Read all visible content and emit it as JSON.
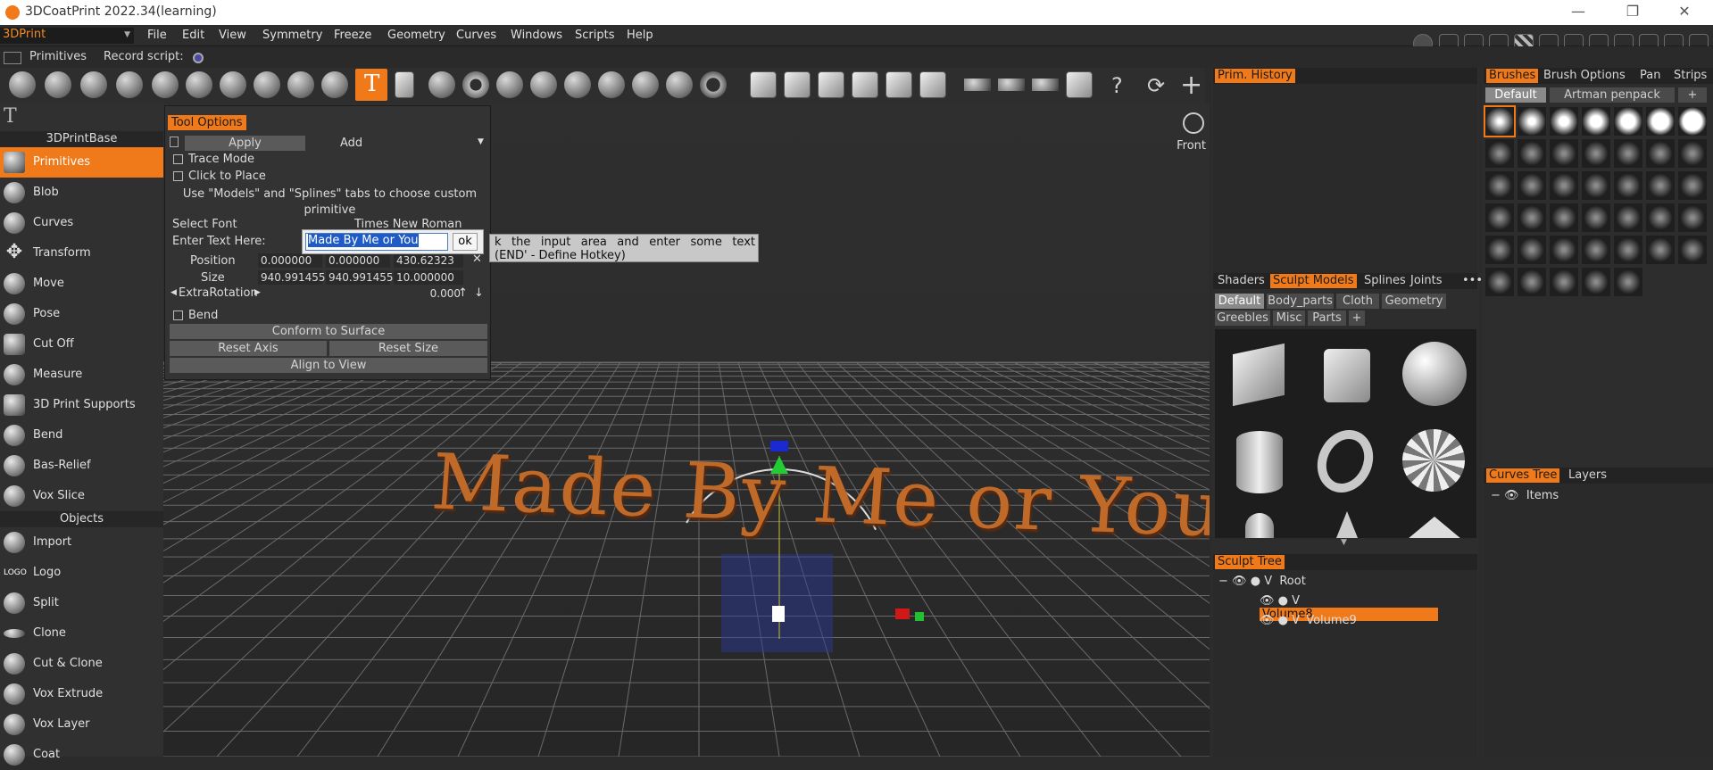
{
  "window": {
    "title": "3DCoatPrint 2022.34(learning)",
    "minimize": "—",
    "restore": "❐",
    "close": "✕"
  },
  "menubar": {
    "room_selector": "3DPrint",
    "items": [
      "File",
      "Edit",
      "View",
      "Symmetry",
      "Freeze",
      "Geometry",
      "Curves",
      "Windows",
      "Scripts",
      "Help"
    ]
  },
  "subbar": {
    "mode": "Primitives",
    "record_label": "Record script:"
  },
  "left_panel": {
    "section1": "3DPrintBase",
    "tools": [
      "Primitives",
      "Blob",
      "Curves",
      "Transform",
      "Move",
      "Pose",
      "Cut Off",
      "Measure",
      "3D Print Supports",
      "Bend",
      "Bas-Relief",
      "Vox Slice"
    ],
    "section2": "Objects",
    "objects": [
      "Import",
      "Logo",
      "Split",
      "Clone",
      "Cut & Clone",
      "Vox Extrude",
      "Vox Layer",
      "Coat"
    ],
    "logo_icon_text": "LOGO",
    "selected": "Primitives"
  },
  "tool_options": {
    "tab": "Tool Options",
    "apply": "Apply",
    "add": "Add",
    "trace_mode": "Trace Mode",
    "click_to_place": "Click to Place",
    "hint": "Use \"Models\" and \"Splines\" tabs to choose custom primitive",
    "select_font": "Select Font",
    "font_value": "Times New Roman",
    "enter_text": "Enter Text Here:",
    "text_value": "Made By Me or You",
    "ok": "ok",
    "position_label": "Position",
    "position": [
      "0.000000",
      "0.000000",
      "430.62323"
    ],
    "size_label": "Size",
    "size": [
      "940.991455",
      "940.991455",
      "10.000000"
    ],
    "extra_rotation_label": "ExtraRotation",
    "extra_rotation": "0.000",
    "bend": "Bend",
    "conform": "Conform to Surface",
    "reset_axis": "Reset Axis",
    "reset_size": "Reset Size",
    "align_view": "Align to View"
  },
  "tooltip": {
    "line1": "k the input area and enter some text",
    "line2": "(END' - Define Hotkey)"
  },
  "viewport": {
    "view_label": "Front",
    "scene_text": "Made By Me or You"
  },
  "prim_history": {
    "tab": "Prim. History"
  },
  "sculpt_models": {
    "tabs": [
      "Shaders",
      "Sculpt Models",
      "Splines",
      "Joints"
    ],
    "active_tab": "Sculpt Models",
    "categories": [
      "Default",
      "Body_parts",
      "Cloth",
      "Geometry",
      "Greebles",
      "Misc",
      "Parts",
      "+"
    ],
    "models": [
      "cube",
      "rounded-cube",
      "sphere",
      "cylinder",
      "torus",
      "spiky-ball",
      "capsule",
      "cone",
      "pyramid"
    ]
  },
  "sculpt_tree": {
    "tab": "Sculpt Tree",
    "rows": [
      {
        "name": "Root",
        "prefix": "V"
      },
      {
        "name": "Volume8",
        "prefix": "V",
        "selected": true
      },
      {
        "name": "Volume9",
        "prefix": "V"
      }
    ]
  },
  "brushes": {
    "tabs": [
      "Brushes",
      "Brush Options",
      "Pan",
      "Strips"
    ],
    "active_tab": "Brushes",
    "sets": [
      "Default",
      "Artman penpack",
      "+"
    ]
  },
  "curves_tree": {
    "tabs": [
      "Curves Tree",
      "Layers"
    ],
    "items_label": "Items"
  },
  "colors": {
    "accent": "#f07a1a",
    "panel": "#2d2d2d",
    "viewport": "#2c2c2c"
  }
}
